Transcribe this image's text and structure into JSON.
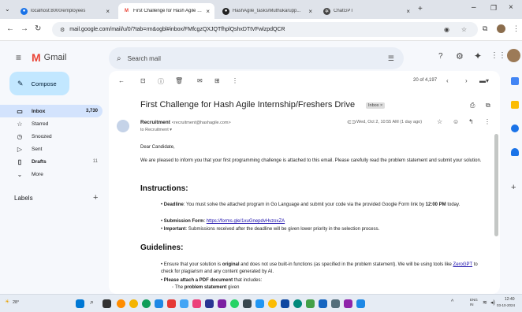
{
  "tabs": [
    {
      "label": "localhost:8000/employees",
      "icon": "globe-icon"
    },
    {
      "label": "First Challenge for Hash Agile Inte",
      "icon": "gmail-icon"
    },
    {
      "label": "HashAgile_tasks/Muthukarupp...",
      "icon": "github-icon"
    },
    {
      "label": "ChatGPT",
      "icon": "chatgpt-icon"
    }
  ],
  "address": {
    "url": "mail.google.com/mail/u/0/?tab=rm&ogbl#inbox/FMfcgzQXJQTfhplQshxDTtVFwlzpdQCR"
  },
  "gmail": {
    "logo_text": "Gmail",
    "search_placeholder": "Search mail",
    "compose": "Compose",
    "labels_title": "Labels",
    "sidebar": [
      {
        "label": "Inbox",
        "count": "3,730",
        "icon": "inbox-icon",
        "active": true
      },
      {
        "label": "Starred",
        "count": "",
        "icon": "star-icon"
      },
      {
        "label": "Snoozed",
        "count": "",
        "icon": "clock-icon"
      },
      {
        "label": "Sent",
        "count": "",
        "icon": "send-icon"
      },
      {
        "label": "Drafts",
        "count": "11",
        "icon": "draft-icon"
      },
      {
        "label": "More",
        "count": "",
        "icon": "chevron-down-icon"
      }
    ]
  },
  "mail": {
    "pager": "20 of 4,197",
    "subject": "First Challenge for Hash Agile Internship/Freshers Drive",
    "inbox_chip": "Inbox ×",
    "sender_name": "Recruitment",
    "sender_email": "<recruitment@hashagile.com>",
    "to_line": "to Recruitment ▾",
    "date": "Wed, Oct 2, 10:55 AM (1 day ago)",
    "greeting": "Dear Candidate,",
    "intro": "We are pleased to inform you that your first programming challenge is attached to this email. Please carefully read the problem statement and submit your solution.",
    "instructions_title": "Instructions:",
    "instructions": [
      {
        "strong": "Deadline",
        "text": ": You must solve the attached program in Go Language and submit your code via the provided Google Form link by ",
        "strong2": "12:00 PM",
        "text2": " today."
      },
      {
        "strong": "Submission Form",
        "text": ": ",
        "link": "https://forms.gle/1xuGnepdvHvzoxZA",
        "text2": ""
      },
      {
        "strong": "Important",
        "text": ": Submissions received after the deadline will be given lower priority in the selection process.",
        "text2": ""
      }
    ],
    "guidelines_title": "Guidelines:",
    "guidelines": [
      {
        "pre": "Ensure that your solution is ",
        "strong": "original",
        "mid": " and does not use built-in functions (as specified in the problem statement). We will be using tools like ",
        "link": "ZeroGPT",
        "post": " to check for plagiarism and any content generated by AI."
      },
      {
        "pre": "",
        "strong": "Please attach a PDF document",
        "mid": " that includes:",
        "link": "",
        "post": ""
      }
    ],
    "sub_bullet": {
      "pre": "The ",
      "strong": "problem statement",
      "post": " given"
    }
  },
  "taskbar": {
    "weather": "28°",
    "lang": "ENG\nIN",
    "time": "12:40",
    "date": "03-10-2024"
  },
  "colors": {
    "accent": "#0b57d0",
    "compose_bg": "#c2e7ff",
    "inbox_active": "#d3e3fd",
    "gmail_red": "#ea4335"
  }
}
